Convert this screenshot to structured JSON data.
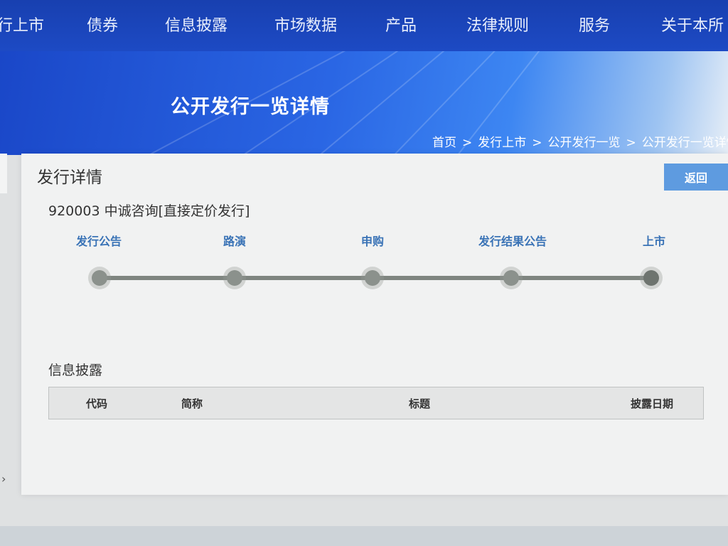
{
  "nav": {
    "items": [
      "行上市",
      "债券",
      "信息披露",
      "市场数据",
      "产品",
      "法律规则",
      "服务",
      "关于本所"
    ]
  },
  "banner": {
    "title": "公开发行一览详情"
  },
  "breadcrumb": {
    "items": [
      "首页",
      "发行上市",
      "公开发行一览",
      "公开发行一览详情"
    ],
    "separator": ">"
  },
  "card": {
    "title": "发行详情",
    "back_label": "返回",
    "issue_title": "920003 中诚咨询[直接定价发行]"
  },
  "timeline": {
    "stages": [
      "发行公告",
      "路演",
      "申购",
      "发行结果公告",
      "上市"
    ]
  },
  "disclosure": {
    "section_title": "信息披露",
    "columns": [
      "代码",
      "简称",
      "标题",
      "披露日期"
    ],
    "rows": []
  },
  "colors": {
    "nav_bg": "#1840b0",
    "stage_label": "#3a73b6",
    "back_button": "#5e9be0",
    "track": "#7f8580"
  }
}
